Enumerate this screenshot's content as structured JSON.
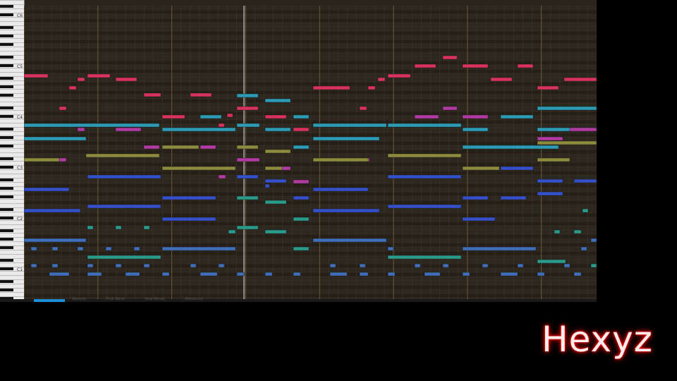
{
  "watermark": "Hexyz",
  "octave_labels": [
    "C6",
    "C5",
    "C4",
    "C3",
    "C2",
    "C1"
  ],
  "status_tabs": [
    "Velocity",
    "Pitch Bend",
    "Mod Wheel",
    "Aftertouch"
  ],
  "colors": {
    "background": "#000000",
    "grid": "#2c271f",
    "active_tab": "#1e8fd6",
    "watermark_glow": "#ff0000"
  },
  "note_colors": {
    "crimson": "#d8335e",
    "magenta": "#b23aa3",
    "teal": "#2d9bb5",
    "olive": "#8b8a3f",
    "blue": "#3550c8",
    "sea": "#2a9a8a",
    "slate": "#3f6fb8"
  }
}
